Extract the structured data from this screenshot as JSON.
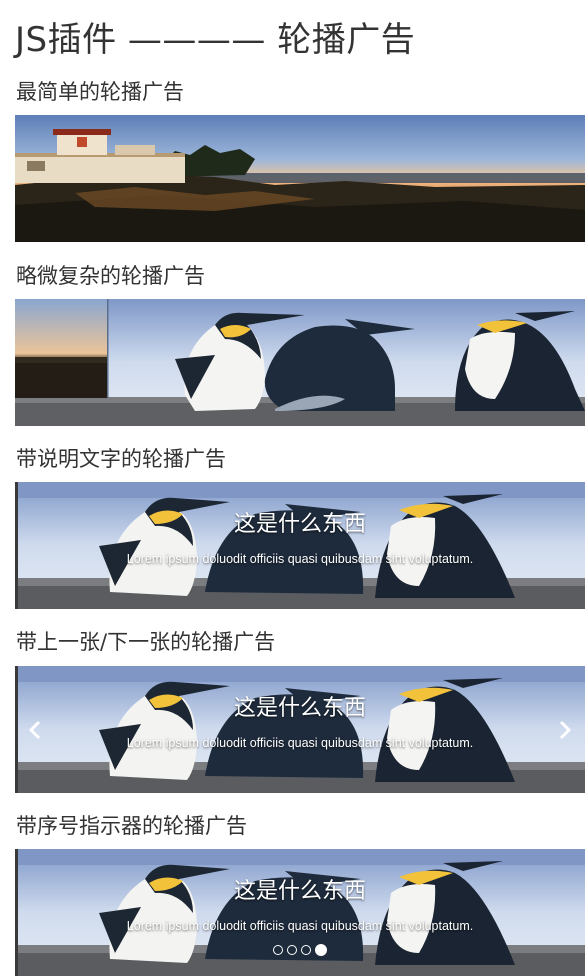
{
  "page": {
    "title": "JS插件 ———— 轮播广告"
  },
  "sections": [
    {
      "heading": "最简单的轮播广告"
    },
    {
      "heading": "略微复杂的轮播广告"
    },
    {
      "heading": "带说明文字的轮播广告"
    },
    {
      "heading": "带上一张/下一张的轮播广告"
    },
    {
      "heading": "带序号指示器的轮播广告"
    }
  ],
  "slide": {
    "caption_title": "这是什么东西",
    "caption_text": "Lorem ipsum doluodit officiis quasi quibusdam sint voluptatum."
  },
  "controls": {
    "prev_icon": "chevron-left-icon",
    "next_icon": "chevron-right-icon"
  },
  "indicators": {
    "count": 4,
    "active_index": 3
  },
  "colors": {
    "text": "#333333",
    "caption": "#ffffff",
    "sky": "#9fb7d8",
    "sunset": "#f2c48a",
    "rock": "#2a2a22"
  }
}
